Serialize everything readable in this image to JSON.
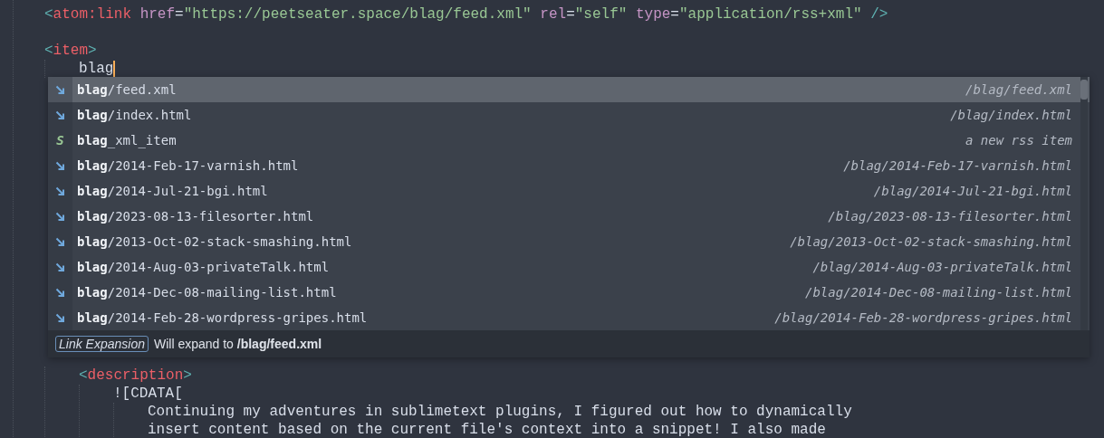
{
  "code_above": [
    {
      "kind": "code",
      "tokens": [
        {
          "kind": "bracket",
          "text": "<"
        },
        {
          "kind": "tag",
          "text": "atom:link"
        },
        {
          "kind": "attr",
          "text": " href"
        },
        {
          "kind": "text",
          "text": "="
        },
        {
          "kind": "string",
          "text": "\"https://peetseater.space/blag/feed.xml\""
        },
        {
          "kind": "attr",
          "text": " rel"
        },
        {
          "kind": "text",
          "text": "="
        },
        {
          "kind": "string",
          "text": "\"self\""
        },
        {
          "kind": "attr",
          "text": " type"
        },
        {
          "kind": "text",
          "text": "="
        },
        {
          "kind": "string",
          "text": "\"application/rss+xml\""
        },
        {
          "kind": "bracket",
          "text": " />"
        }
      ]
    },
    {
      "kind": "blank"
    },
    {
      "kind": "code",
      "tokens": [
        {
          "kind": "bracket",
          "text": "<"
        },
        {
          "kind": "tag",
          "text": "item"
        },
        {
          "kind": "bracket",
          "text": ">"
        }
      ],
      "children": [
        {
          "kind": "code",
          "caret": true,
          "tokens": [
            {
              "kind": "text",
              "text": "blag"
            }
          ]
        }
      ]
    }
  ],
  "completions": [
    {
      "kind": "link",
      "match": "blag",
      "rest": "/feed.xml",
      "annotation": "/blag/feed.xml",
      "selected": true
    },
    {
      "kind": "link",
      "match": "blag",
      "rest": "/index.html",
      "annotation": "/blag/index.html",
      "selected": false
    },
    {
      "kind": "snippet",
      "kind_label": "S",
      "match": "blag",
      "rest": "_xml_item",
      "annotation": "a new rss item",
      "selected": false
    },
    {
      "kind": "link",
      "match": "blag",
      "rest": "/2014-Feb-17-varnish.html",
      "annotation": "/blag/2014-Feb-17-varnish.html",
      "selected": false
    },
    {
      "kind": "link",
      "match": "blag",
      "rest": "/2014-Jul-21-bgi.html",
      "annotation": "/blag/2014-Jul-21-bgi.html",
      "selected": false
    },
    {
      "kind": "link",
      "match": "blag",
      "rest": "/2023-08-13-filesorter.html",
      "annotation": "/blag/2023-08-13-filesorter.html",
      "selected": false
    },
    {
      "kind": "link",
      "match": "blag",
      "rest": "/2013-Oct-02-stack-smashing.html",
      "annotation": "/blag/2013-Oct-02-stack-smashing.html",
      "selected": false
    },
    {
      "kind": "link",
      "match": "blag",
      "rest": "/2014-Aug-03-privateTalk.html",
      "annotation": "/blag/2014-Aug-03-privateTalk.html",
      "selected": false
    },
    {
      "kind": "link",
      "match": "blag",
      "rest": "/2014-Dec-08-mailing-list.html",
      "annotation": "/blag/2014-Dec-08-mailing-list.html",
      "selected": false
    },
    {
      "kind": "link",
      "match": "blag",
      "rest": "/2014-Feb-28-wordpress-gripes.html",
      "annotation": "/blag/2014-Feb-28-wordpress-gripes.html",
      "selected": false
    }
  ],
  "details": {
    "badge": "Link Expansion",
    "text": "Will expand to **/blag/feed.xml**"
  },
  "code_below": [
    {
      "kind": "code",
      "tokens": [
        {
          "kind": "bracket",
          "text": "<"
        },
        {
          "kind": "tag",
          "text": "description"
        },
        {
          "kind": "bracket",
          "text": ">"
        }
      ],
      "children": [
        {
          "kind": "code",
          "tokens": [
            {
              "kind": "text",
              "text": "![CDATA["
            }
          ],
          "children": [
            {
              "kind": "code",
              "tokens": [
                {
                  "kind": "text",
                  "text": "Continuing my adventures in sublimetext plugins, I figured out how to dynamically"
                }
              ]
            },
            {
              "kind": "code",
              "tokens": [
                {
                  "kind": "text",
                  "text": "insert content based on the current file's context into a snippet! I also made"
                }
              ]
            }
          ]
        }
      ]
    }
  ]
}
